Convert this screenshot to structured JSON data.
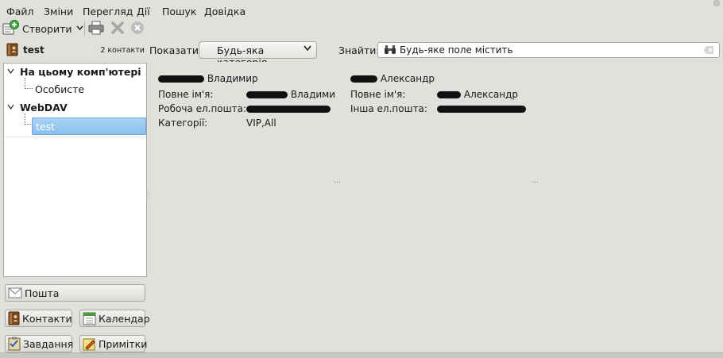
{
  "menu": {
    "items": [
      {
        "label": "Файл",
        "accel": "Ф",
        "rest": "айл"
      },
      {
        "label": "Зміни",
        "accel": "м",
        "pre": "З",
        "rest": "іни"
      },
      {
        "label": "Перегляд",
        "accel": "е",
        "pre": "П",
        "rest": "регляд"
      },
      {
        "label": "Дії",
        "accel": "і",
        "pre": "Д",
        "rest": "ї"
      },
      {
        "label": "Пошук",
        "accel": "П",
        "rest": "ошук"
      },
      {
        "label": "Довідка",
        "accel": "Д",
        "rest": "овідка"
      }
    ]
  },
  "toolbar": {
    "new_label": "Створити",
    "icons": [
      "new-contact-icon",
      "print-icon",
      "delete-icon",
      "stop-icon"
    ]
  },
  "sidebar": {
    "title": "test",
    "count": "2 контакти",
    "tree": {
      "group1": "На цьому комп'ютері",
      "group1_child": "Особисте",
      "group2": "WebDAV",
      "group2_child": "test"
    },
    "buttons": {
      "mail": "Пошта",
      "contacts": "Контакти",
      "calendar": "Календар",
      "tasks": "Завдання",
      "memos": "Примітки"
    }
  },
  "filter": {
    "show_label": "Показати:",
    "category": "Будь-яка категорія",
    "find_label": "Знайти:",
    "find_placeholder": "Будь-яке поле містить"
  },
  "contacts": [
    {
      "name": "Владимир",
      "full_name_label": "Повне ім'я:",
      "full_name": "Владими",
      "email_label": "Робоча ел.пошта:",
      "category_label": "Категорії:",
      "categories": "VIP,All"
    },
    {
      "name": "Александр",
      "full_name_label": "Повне ім'я:",
      "full_name": "Александр",
      "email_label": "Інша ел.пошта:"
    }
  ],
  "colors": {
    "background": "#e2e0dd",
    "selection": "#8cc0ee",
    "redaction": "#111111"
  }
}
